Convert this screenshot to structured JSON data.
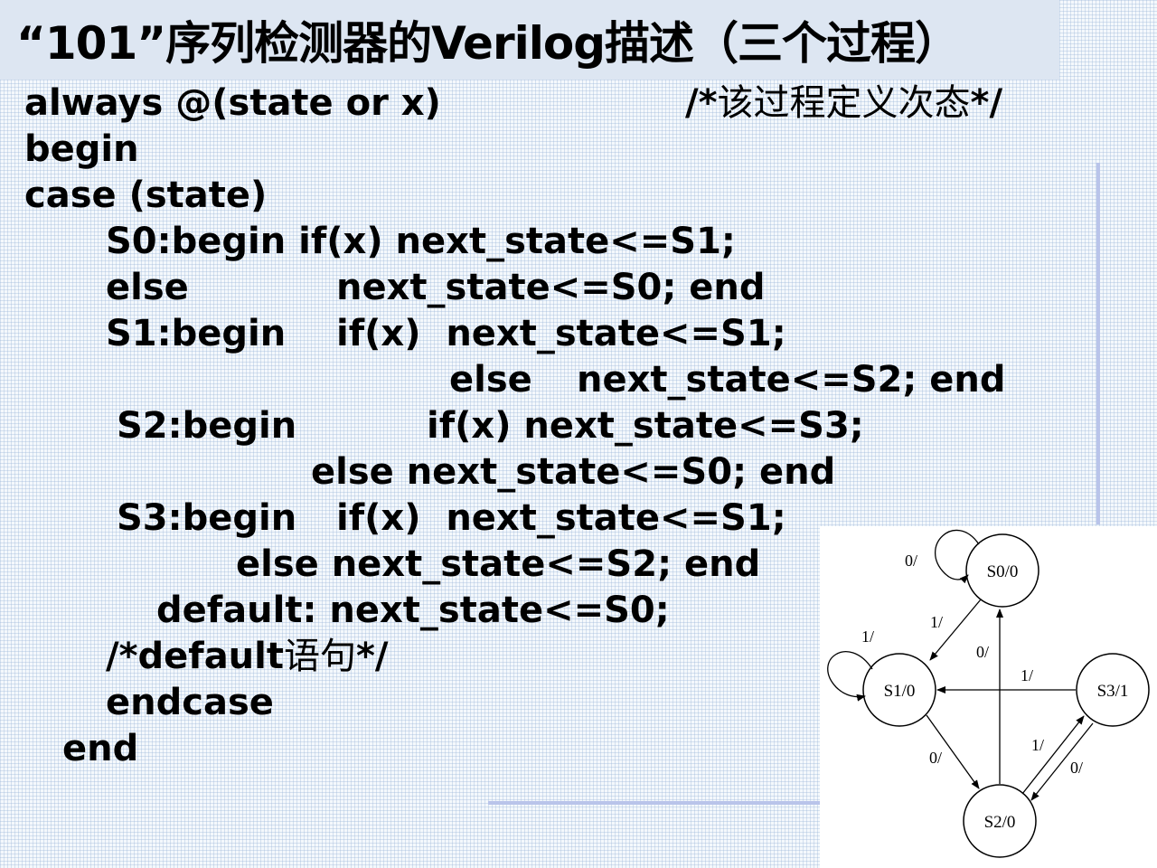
{
  "title": "“101”序列检测器的Verilog描述（三个过程）",
  "code": {
    "l1a": "always @(state or x)",
    "l1b": "/*",
    "l1c": "该过程定义次态",
    "l1d": "*/",
    "l2": "begin",
    "l3": "case (state)",
    "l4": "S0:begin if(x) next_state<=S1;",
    "l5a": "else",
    "l5b": "next_state<=S0; end",
    "l6a": "S1:begin",
    "l6b": "if(x)  next_state<=S1;",
    "l7a": "else",
    "l7b": "next_state<=S2; end",
    "l8a": "S2:begin",
    "l8b": "if(x) next_state<=S3;",
    "l9": "else next_state<=S0; end",
    "l10a": "S3:begin",
    "l10b": "if(x)  next_state<=S1;",
    "l11": "else next_state<=S2; end",
    "l12": "default: next_state<=S0;",
    "l13a": "/*default",
    "l13b": "语句",
    "l13c": "*/",
    "l14": "endcase",
    "l15": "end"
  },
  "diagram": {
    "nodes": {
      "s0": "S0/0",
      "s1": "S1/0",
      "s2": "S2/0",
      "s3": "S3/1"
    },
    "edges": {
      "s0_self": "0/",
      "s1_self": "1/",
      "s0_to_s1": "1/",
      "s2_to_s0": "0/",
      "s3_to_s1": "1/",
      "s1_to_s2": "0/",
      "s2_to_s3": "1/",
      "s3_to_s2": "0/"
    }
  }
}
